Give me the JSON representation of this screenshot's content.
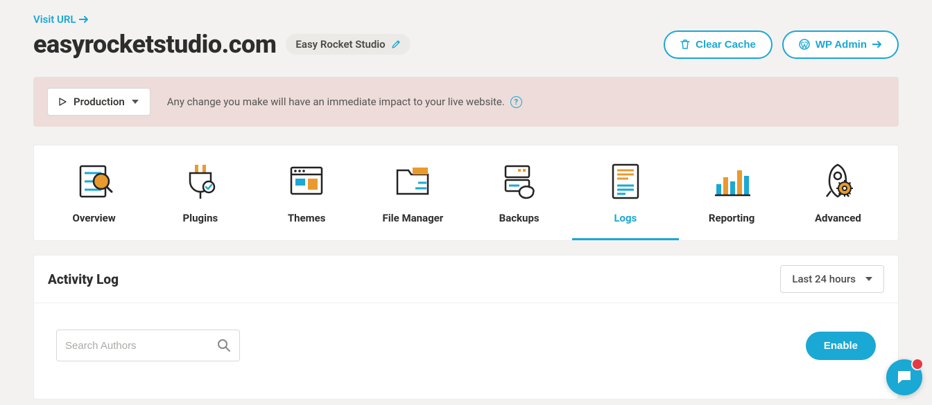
{
  "header": {
    "visit_url": "Visit URL",
    "domain": "easyrocketstudio.com",
    "site_name": "Easy Rocket Studio",
    "clear_cache": "Clear Cache",
    "wp_admin": "WP Admin"
  },
  "notice": {
    "environment": "Production",
    "text": "Any change you make will have an immediate impact to your live website."
  },
  "tabs": [
    {
      "label": "Overview"
    },
    {
      "label": "Plugins"
    },
    {
      "label": "Themes"
    },
    {
      "label": "File Manager"
    },
    {
      "label": "Backups"
    },
    {
      "label": "Logs"
    },
    {
      "label": "Reporting"
    },
    {
      "label": "Advanced"
    }
  ],
  "activity": {
    "title": "Activity Log",
    "range": "Last 24 hours",
    "search_placeholder": "Search Authors",
    "enable": "Enable"
  },
  "colors": {
    "accent": "#1aa8d4",
    "orange": "#e99a2e"
  }
}
